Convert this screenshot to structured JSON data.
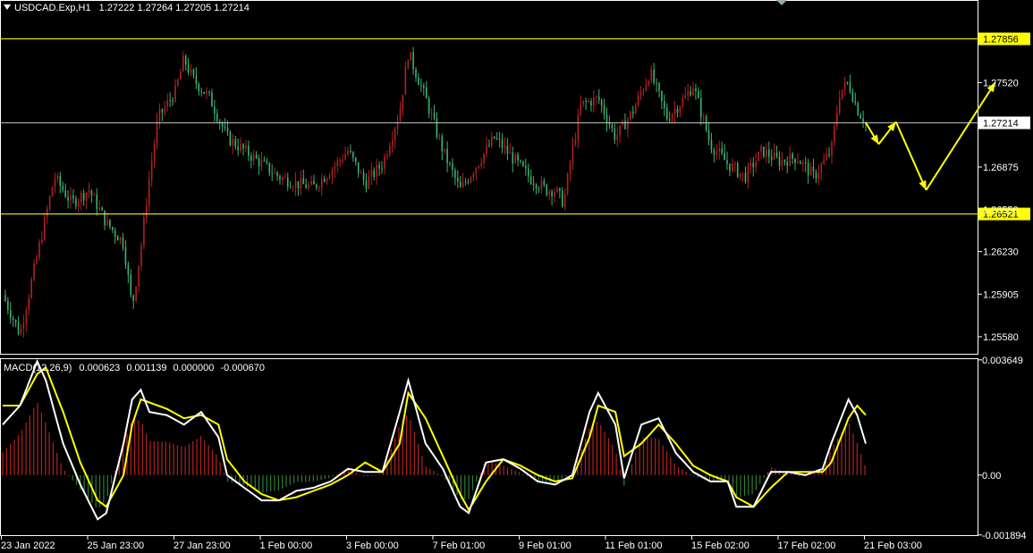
{
  "header": {
    "symbol": "USDCAD.Exp,H1",
    "open": "1.27222",
    "high": "1.27264",
    "low": "1.27205",
    "close": "1.27214"
  },
  "macd_header": {
    "label": "MACD(12,26,9)",
    "v1": "0.000623",
    "v2": "0.001139",
    "v3": "0.000000",
    "v4": "-0.000670"
  },
  "colors": {
    "background": "#000000",
    "bull": "#b22222",
    "bear": "#3cb371",
    "level_line": "#ffff00",
    "current_price_line": "#c0c0c0",
    "arrow": "#ffff00",
    "macd_line": "#ffffff",
    "signal_line": "#ffff00",
    "hist_pos": "#b22222",
    "hist_neg": "#2e7d32",
    "axis": "#ffffff"
  },
  "chart_data": [
    {
      "type": "candlestick",
      "title": "USDCAD.Exp,H1",
      "ylim": [
        1.2545,
        1.2815
      ],
      "price_ticks": [
        "1.27520",
        "1.26875",
        "1.26230",
        "1.25905",
        "1.25580",
        "1.26550"
      ],
      "levels": [
        {
          "value": 1.27856,
          "label": "1.27856",
          "color": "yellow"
        },
        {
          "value": 1.26521,
          "label": "1.26521",
          "color": "yellow"
        }
      ],
      "current_price": {
        "value": 1.27214,
        "label": "1.27214"
      },
      "time_labels": [
        "23 Jan 2022",
        "25 Jan 23:00",
        "27 Jan 23:00",
        "1 Feb 00:00",
        "3 Feb 00:00",
        "7 Feb 01:00",
        "9 Feb 01:00",
        "11 Feb 01:00",
        "15 Feb 02:00",
        "17 Feb 02:00",
        "21 Feb 03:00"
      ],
      "close_series": [
        [
          0,
          1.259
        ],
        [
          2,
          1.256
        ],
        [
          4,
          1.262
        ],
        [
          6,
          1.268
        ],
        [
          8,
          1.266
        ],
        [
          10,
          1.267
        ],
        [
          12,
          1.2645
        ],
        [
          14,
          1.263
        ],
        [
          15,
          1.258
        ],
        [
          16,
          1.2625
        ],
        [
          17,
          1.268
        ],
        [
          18,
          1.2725
        ],
        [
          20,
          1.2745
        ],
        [
          21,
          1.277
        ],
        [
          22,
          1.2755
        ],
        [
          24,
          1.274
        ],
        [
          26,
          1.271
        ],
        [
          28,
          1.27
        ],
        [
          30,
          1.269
        ],
        [
          32,
          1.268
        ],
        [
          34,
          1.2675
        ],
        [
          36,
          1.2672
        ],
        [
          38,
          1.2685
        ],
        [
          40,
          1.27
        ],
        [
          42,
          1.2675
        ],
        [
          44,
          1.269
        ],
        [
          46,
          1.273
        ],
        [
          47,
          1.2775
        ],
        [
          49,
          1.274
        ],
        [
          51,
          1.27
        ],
        [
          53,
          1.267
        ],
        [
          55,
          1.269
        ],
        [
          57,
          1.271
        ],
        [
          59,
          1.2695
        ],
        [
          61,
          1.268
        ],
        [
          63,
          1.267
        ],
        [
          64,
          1.267
        ],
        [
          65,
          1.266
        ],
        [
          66,
          1.27
        ],
        [
          67,
          1.2735
        ],
        [
          69,
          1.274
        ],
        [
          71,
          1.271
        ],
        [
          73,
          1.273
        ],
        [
          75,
          1.276
        ],
        [
          77,
          1.2725
        ],
        [
          79,
          1.274
        ],
        [
          80,
          1.275
        ],
        [
          82,
          1.2705
        ],
        [
          84,
          1.269
        ],
        [
          86,
          1.268
        ],
        [
          88,
          1.27
        ],
        [
          90,
          1.2692
        ],
        [
          92,
          1.2695
        ],
        [
          94,
          1.268
        ],
        [
          96,
          1.27
        ],
        [
          97,
          1.2745
        ],
        [
          98,
          1.2752
        ],
        [
          99,
          1.2732
        ],
        [
          100,
          1.2721
        ]
      ],
      "projection_arrows": [
        [
          100,
          1.27214
        ],
        [
          101.5,
          1.2705
        ],
        [
          103.5,
          1.2722
        ],
        [
          107,
          1.267
        ],
        [
          115,
          1.2752
        ]
      ]
    },
    {
      "type": "line",
      "title": "MACD(12,26,9)",
      "ylim": [
        -0.0019,
        0.0037
      ],
      "y_ticks": [
        "0.003649",
        "0.00",
        "-0.001894"
      ],
      "series": [
        {
          "name": "MACD",
          "values": [
            [
              0,
              0.0016
            ],
            [
              2,
              0.0022
            ],
            [
              4,
              0.0036
            ],
            [
              5,
              0.003
            ],
            [
              7,
              0.001
            ],
            [
              9,
              -0.0003
            ],
            [
              11,
              -0.0014
            ],
            [
              12,
              -0.0012
            ],
            [
              14,
              0.001
            ],
            [
              15,
              0.0024
            ],
            [
              16,
              0.0027
            ],
            [
              17,
              0.002
            ],
            [
              19,
              0.0019
            ],
            [
              21,
              0.0016
            ],
            [
              23,
              0.002
            ],
            [
              25,
              0.0012
            ],
            [
              26,
              0.0
            ],
            [
              28,
              -0.0004
            ],
            [
              30,
              -0.0008
            ],
            [
              32,
              -0.0008
            ],
            [
              34,
              -0.0005
            ],
            [
              36,
              -0.0004
            ],
            [
              38,
              -0.0002
            ],
            [
              40,
              0.0002
            ],
            [
              42,
              0.0001
            ],
            [
              44,
              0.0001
            ],
            [
              46,
              0.002
            ],
            [
              47,
              0.003
            ],
            [
              49,
              0.001
            ],
            [
              51,
              0.0002
            ],
            [
              53,
              -0.001
            ],
            [
              54,
              -0.0012
            ],
            [
              56,
              0.0004
            ],
            [
              58,
              0.0005
            ],
            [
              60,
              0.0002
            ],
            [
              62,
              -0.0002
            ],
            [
              64,
              -0.0003
            ],
            [
              66,
              0.0
            ],
            [
              68,
              0.002
            ],
            [
              69,
              0.0026
            ],
            [
              71,
              0.0016
            ],
            [
              72,
              -0.0001
            ],
            [
              74,
              0.0016
            ],
            [
              76,
              0.0018
            ],
            [
              78,
              0.0007
            ],
            [
              80,
              0.0001
            ],
            [
              82,
              -0.0002
            ],
            [
              84,
              -0.0002
            ],
            [
              85,
              -0.001
            ],
            [
              87,
              -0.001
            ],
            [
              89,
              0.0001
            ],
            [
              91,
              0.0001
            ],
            [
              93,
              0.0
            ],
            [
              95,
              0.0002
            ],
            [
              96,
              0.001
            ],
            [
              98,
              0.0024
            ],
            [
              99,
              0.0019
            ],
            [
              100,
              0.001
            ]
          ]
        },
        {
          "name": "Signal",
          "values": [
            [
              0,
              0.0022
            ],
            [
              2,
              0.0022
            ],
            [
              4,
              0.0032
            ],
            [
              5,
              0.0034
            ],
            [
              7,
              0.002
            ],
            [
              9,
              0.0004
            ],
            [
              11,
              -0.0008
            ],
            [
              12,
              -0.001
            ],
            [
              14,
              0.0
            ],
            [
              15,
              0.0016
            ],
            [
              16,
              0.0024
            ],
            [
              17,
              0.0023
            ],
            [
              19,
              0.0021
            ],
            [
              21,
              0.0018
            ],
            [
              23,
              0.0019
            ],
            [
              25,
              0.0016
            ],
            [
              26,
              0.0005
            ],
            [
              28,
              -0.0002
            ],
            [
              30,
              -0.0006
            ],
            [
              32,
              -0.0008
            ],
            [
              34,
              -0.0007
            ],
            [
              36,
              -0.0005
            ],
            [
              38,
              -0.0003
            ],
            [
              40,
              0.0
            ],
            [
              42,
              0.0004
            ],
            [
              44,
              0.0001
            ],
            [
              46,
              0.001
            ],
            [
              47,
              0.0026
            ],
            [
              49,
              0.0018
            ],
            [
              51,
              0.0006
            ],
            [
              53,
              -0.0006
            ],
            [
              54,
              -0.0011
            ],
            [
              56,
              -0.0002
            ],
            [
              58,
              0.0005
            ],
            [
              60,
              0.0003
            ],
            [
              62,
              0.0
            ],
            [
              64,
              -0.0002
            ],
            [
              66,
              -0.0001
            ],
            [
              68,
              0.0012
            ],
            [
              69,
              0.0022
            ],
            [
              71,
              0.002
            ],
            [
              72,
              0.0006
            ],
            [
              74,
              0.001
            ],
            [
              76,
              0.0016
            ],
            [
              78,
              0.001
            ],
            [
              80,
              0.0003
            ],
            [
              82,
              0.0
            ],
            [
              84,
              -0.0002
            ],
            [
              85,
              -0.0007
            ],
            [
              87,
              -0.001
            ],
            [
              89,
              -0.0004
            ],
            [
              91,
              0.0001
            ],
            [
              93,
              0.0001
            ],
            [
              95,
              0.0001
            ],
            [
              96,
              0.0004
            ],
            [
              98,
              0.0018
            ],
            [
              99,
              0.0022
            ],
            [
              100,
              0.0019
            ]
          ]
        }
      ]
    }
  ]
}
